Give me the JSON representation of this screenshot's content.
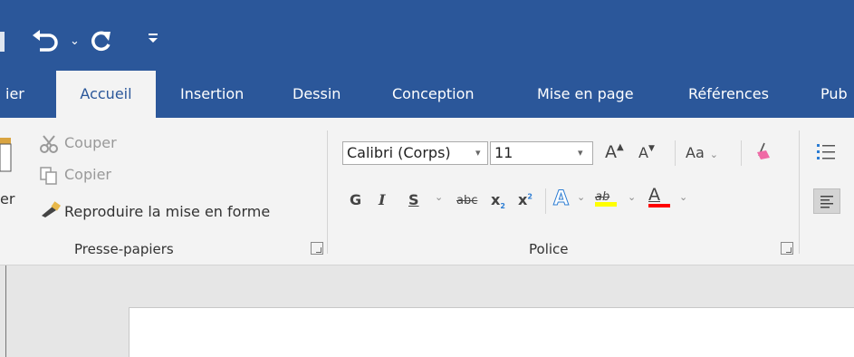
{
  "tabs": [
    {
      "label": "ier"
    },
    {
      "label": "Accueil"
    },
    {
      "label": "Insertion"
    },
    {
      "label": "Dessin"
    },
    {
      "label": "Conception"
    },
    {
      "label": "Mise en page"
    },
    {
      "label": "Références"
    },
    {
      "label": "Pub"
    }
  ],
  "clipboard": {
    "paste_label": "er",
    "cut": "Couper",
    "copy": "Copier",
    "format_painter": "Reproduire la mise en forme",
    "group_label": "Presse-papiers"
  },
  "font": {
    "name": "Calibri (Corps)",
    "size": "11",
    "grow": "A",
    "shrink": "A",
    "case": "Aa",
    "bold": "G",
    "italic": "I",
    "underline": "S",
    "strike": "abc",
    "subscript": "x",
    "superscript": "x",
    "sub_mark": "2",
    "sup_mark": "2",
    "effects": "A",
    "highlight": "ab",
    "color": "A",
    "group_label": "Police"
  },
  "colors": {
    "titlebar": "#2b579a",
    "ribbon": "#f3f3f3",
    "highlight": "#ffff00",
    "font_color": "#ff0000"
  }
}
